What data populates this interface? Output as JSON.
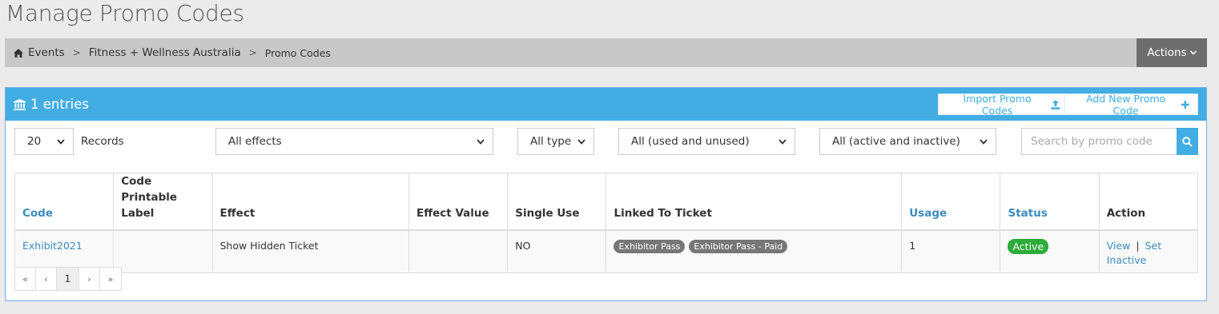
{
  "page": {
    "title": "Manage Promo Codes"
  },
  "breadcrumb": {
    "items": [
      "Events",
      "Fitness + Wellness Australia",
      "Promo Codes"
    ],
    "separator": ">"
  },
  "actions": {
    "label": "Actions"
  },
  "panel": {
    "entries_label": "1 entries",
    "import_label": "Import Promo Codes",
    "add_new_label": "Add New Promo Code",
    "header_color": "#42ade2"
  },
  "filters": {
    "records_value": "20",
    "records_label": "Records",
    "effect_value": "All effects",
    "type_value": "All type",
    "usage_value": "All (used and unused)",
    "status_value": "All (active and inactive)",
    "search_placeholder": "Search by promo code"
  },
  "table": {
    "headers": {
      "code": "Code",
      "label": "Code Printable Label",
      "effect": "Effect",
      "effect_value": "Effect Value",
      "single_use": "Single Use",
      "linked": "Linked To Ticket",
      "usage": "Usage",
      "status": "Status",
      "action": "Action"
    },
    "rows": [
      {
        "code": "Exhibit2021",
        "label": "",
        "effect": "Show Hidden Ticket",
        "effect_value": "",
        "single_use": "NO",
        "tickets": [
          "Exhibitor Pass",
          "Exhibitor Pass - Paid"
        ],
        "usage": "1",
        "status": "Active",
        "action_view": "View",
        "action_sep": "|",
        "action_set_inactive": "Set Inactive"
      }
    ]
  },
  "pagination": {
    "first": "«",
    "prev": "‹",
    "current": "1",
    "next": "›",
    "last": "»"
  }
}
